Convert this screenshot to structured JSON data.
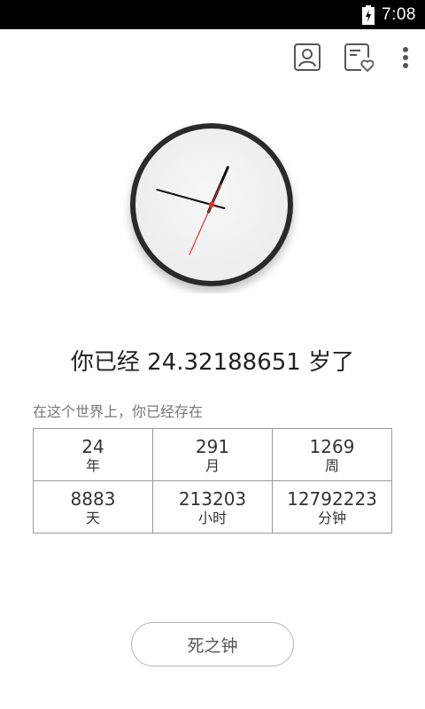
{
  "status_bar": {
    "time": "7:08",
    "battery_icon": "battery-charging-icon"
  },
  "action_bar": {
    "icons": [
      "profile-icon",
      "wishlist-card-icon",
      "more-vert-icon"
    ]
  },
  "clock": {
    "hours": 12,
    "minutes": 47,
    "seconds": 34
  },
  "age": {
    "prefix": "你已经",
    "value": "24.32188651",
    "suffix": "岁了"
  },
  "caption": "在这个世界上，你已经存在",
  "stats": [
    [
      {
        "value": "24",
        "unit": "年"
      },
      {
        "value": "291",
        "unit": "月"
      },
      {
        "value": "1269",
        "unit": "周"
      }
    ],
    [
      {
        "value": "8883",
        "unit": "天"
      },
      {
        "value": "213203",
        "unit": "小时"
      },
      {
        "value": "12792223",
        "unit": "分钟"
      }
    ]
  ],
  "button": {
    "label": "死之钟"
  },
  "colors": {
    "status_bar": "#000000",
    "second_hand": "#e0302a",
    "clock_ring": "#333333"
  }
}
